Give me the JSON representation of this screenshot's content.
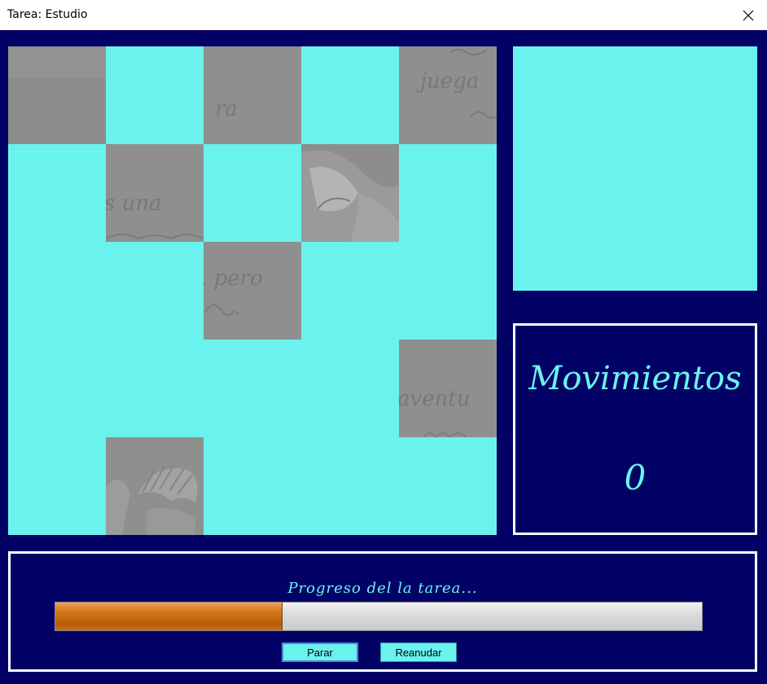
{
  "window": {
    "title": "Tarea: Estudio",
    "close_icon": "close-icon"
  },
  "puzzle": {
    "empty_color": "#6af3ee",
    "tile_color": "#8f8f8f",
    "tiles": [
      {
        "name": "tile-r1-c1",
        "text": ""
      },
      {
        "name": "tile-r1-c3",
        "text": "ra"
      },
      {
        "name": "tile-r1-c5",
        "text": "juega"
      },
      {
        "name": "tile-r2-c2",
        "text": "s una"
      },
      {
        "name": "tile-r2-c4",
        "text": ""
      },
      {
        "name": "tile-r3-c3",
        "text": ". pero"
      },
      {
        "name": "tile-r4-c5",
        "text": "aventu"
      },
      {
        "name": "tile-r5-c2",
        "text": ""
      }
    ]
  },
  "preview": {
    "color": "#6af3ee"
  },
  "counter": {
    "title": "Movimientos",
    "value": "0"
  },
  "progress": {
    "label": "Progreso del la tarea...",
    "percent": 35,
    "fill_color": "#c8680e"
  },
  "buttons": {
    "stop": "Parar",
    "resume": "Reanudar"
  }
}
